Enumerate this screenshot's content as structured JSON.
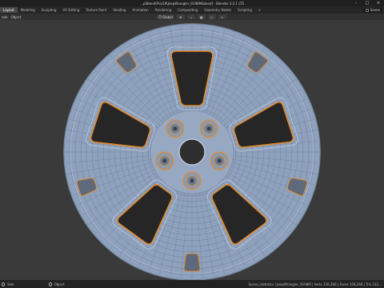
{
  "window": {
    "title": "...p\\Blend\\Pro\\19\\JeepWrangler_9198M\\blend] - Blender 4.2.1 LTS",
    "minimize_icon": "minimize-icon",
    "maximize_icon": "maximize-icon",
    "close_icon": "close-icon"
  },
  "workspaces": [
    {
      "label": "Layout",
      "active": true
    },
    {
      "label": "Modeling"
    },
    {
      "label": "Sculpting"
    },
    {
      "label": "UV Editing"
    },
    {
      "label": "Texture Paint"
    },
    {
      "label": "Shading"
    },
    {
      "label": "Animation"
    },
    {
      "label": "Rendering"
    },
    {
      "label": "Compositing"
    },
    {
      "label": "Geometry Nodes"
    },
    {
      "label": "Scripting"
    },
    {
      "label": "+"
    }
  ],
  "scene": {
    "label": "Scene"
  },
  "header": {
    "mode_label": "ode",
    "object_menu": "Object",
    "transform_orientation": "Global"
  },
  "status": {
    "left_label": "Sele",
    "object_label": "Object",
    "right_text": "Scene_statistics | JeepWrangler_9198M | Verts 156,260 | Faces 156,260 | Tris 312,..."
  },
  "colors": {
    "mesh_fill": "#8fa2bd",
    "wire": "#3a4a63",
    "edge_highlight": "#e38a2b",
    "viewport_bg": "#3a3a3a"
  }
}
